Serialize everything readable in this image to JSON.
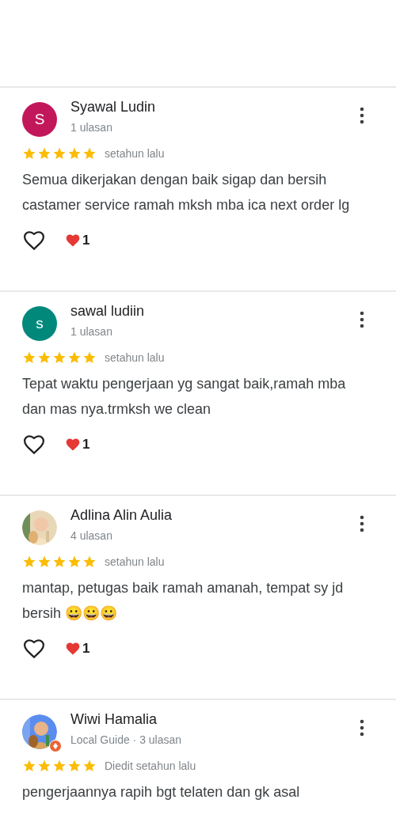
{
  "reviews": [
    {
      "name": "Syawal Ludin",
      "avatar": {
        "kind": "letter",
        "letter": "S",
        "color": "#c2185b"
      },
      "meta": "1 ulasan",
      "local_guide": false,
      "stars": 5,
      "time": "setahun lalu",
      "text": "Semua dikerjakan dengan baik sigap dan bersih castamer service ramah mksh mba ica next order lg",
      "likes": "1"
    },
    {
      "name": "sawal ludiin",
      "avatar": {
        "kind": "letter",
        "letter": "s",
        "color": "#00897b"
      },
      "meta": "1 ulasan",
      "local_guide": false,
      "stars": 5,
      "time": "setahun lalu",
      "text": "Tepat waktu pengerjaan yg sangat baik,ramah mba dan mas nya.trmksh we clean",
      "likes": "1"
    },
    {
      "name": "Adlina Alin Aulia",
      "meta": "4 ulasan",
      "local_guide": false,
      "stars": 5,
      "time": "setahun lalu",
      "text": "mantap, petugas baik ramah amanah, tempat sy jd bersih 😀😀😀",
      "likes": "1"
    },
    {
      "name": "Wiwi Hamalia",
      "meta": "Local Guide · 3 ulasan",
      "local_guide": true,
      "stars": 5,
      "time": "Diedit setahun lalu",
      "text": "pengerjaannya rapih bgt telaten dan gk asal"
    }
  ]
}
